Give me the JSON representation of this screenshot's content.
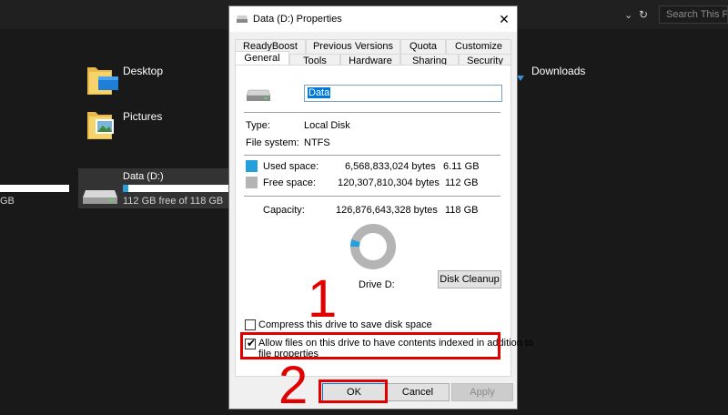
{
  "explorer": {
    "search_placeholder": "Search This PC",
    "folders": [
      {
        "label": "Desktop"
      },
      {
        "label": "Pictures"
      },
      {
        "label": "Downloads"
      }
    ],
    "drive": {
      "name": "Data (D:)",
      "free_text": "112 GB free of 118 GB",
      "used_fraction": 0.05
    },
    "left_drive_gb": "GB"
  },
  "dialog": {
    "title": "Data (D:) Properties",
    "tabs_row1": [
      "ReadyBoost",
      "Previous Versions",
      "Quota",
      "Customize"
    ],
    "tabs_row2": [
      "General",
      "Tools",
      "Hardware",
      "Sharing",
      "Security"
    ],
    "active_tab": "General",
    "name_value": "Data",
    "type_label": "Type:",
    "type_value": "Local Disk",
    "fs_label": "File system:",
    "fs_value": "NTFS",
    "used_label": "Used space:",
    "used_bytes": "6,568,833,024 bytes",
    "used_gb": "6.11 GB",
    "free_label": "Free space:",
    "free_bytes": "120,307,810,304 bytes",
    "free_gb": "112 GB",
    "capacity_label": "Capacity:",
    "capacity_bytes": "126,876,643,328 bytes",
    "capacity_gb": "118 GB",
    "drive_label": "Drive D:",
    "used_fraction": 0.052,
    "disk_cleanup": "Disk Cleanup",
    "compress_label": "Compress this drive to save disk space",
    "compress_checked": false,
    "index_label_1": "Allow files on this drive to have contents indexed in addition to",
    "index_label_2": "file properties",
    "index_checked": true,
    "ok": "OK",
    "cancel": "Cancel",
    "apply": "Apply",
    "colors": {
      "used": "#26a0da",
      "free": "#b4b4b4"
    }
  },
  "annotations": {
    "step1": "1",
    "step2": "2",
    "color": "#e00000"
  }
}
